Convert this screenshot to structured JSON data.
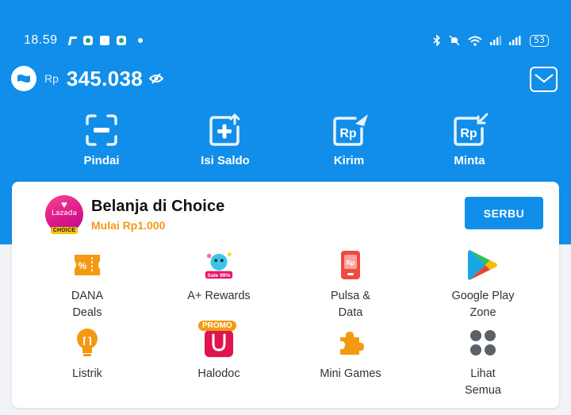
{
  "status_bar": {
    "time": "18.59",
    "battery": "53"
  },
  "balance": {
    "currency": "Rp",
    "amount": "345.038"
  },
  "actions": [
    {
      "label": "Pindai",
      "icon": "scan-icon"
    },
    {
      "label": "Isi Saldo",
      "icon": "top-up-icon"
    },
    {
      "label": "Kirim",
      "icon": "send-icon"
    },
    {
      "label": "Minta",
      "icon": "request-icon"
    }
  ],
  "promo": {
    "logo_text": "Lazada",
    "logo_badge": "CHOICE",
    "title": "Belanja di Choice",
    "subtitle": "Mulai Rp1.000",
    "button": "SERBU"
  },
  "services": [
    {
      "label": "DANA\nDeals",
      "icon": "deals-coupon-icon"
    },
    {
      "label": "A+ Rewards",
      "icon": "rewards-icon"
    },
    {
      "label": "Pulsa &\nData",
      "icon": "phone-credit-icon"
    },
    {
      "label": "Google Play\nZone",
      "icon": "google-play-icon"
    },
    {
      "label": "Listrik",
      "icon": "lightbulb-icon"
    },
    {
      "label": "Halodoc",
      "icon": "halodoc-icon",
      "badge": "PROMO"
    },
    {
      "label": "Mini Games",
      "icon": "puzzle-icon"
    },
    {
      "label": "Lihat\nSemua",
      "icon": "view-all-icon"
    }
  ],
  "colors": {
    "brand_blue": "#118ee9",
    "accent_orange": "#f39a12"
  }
}
